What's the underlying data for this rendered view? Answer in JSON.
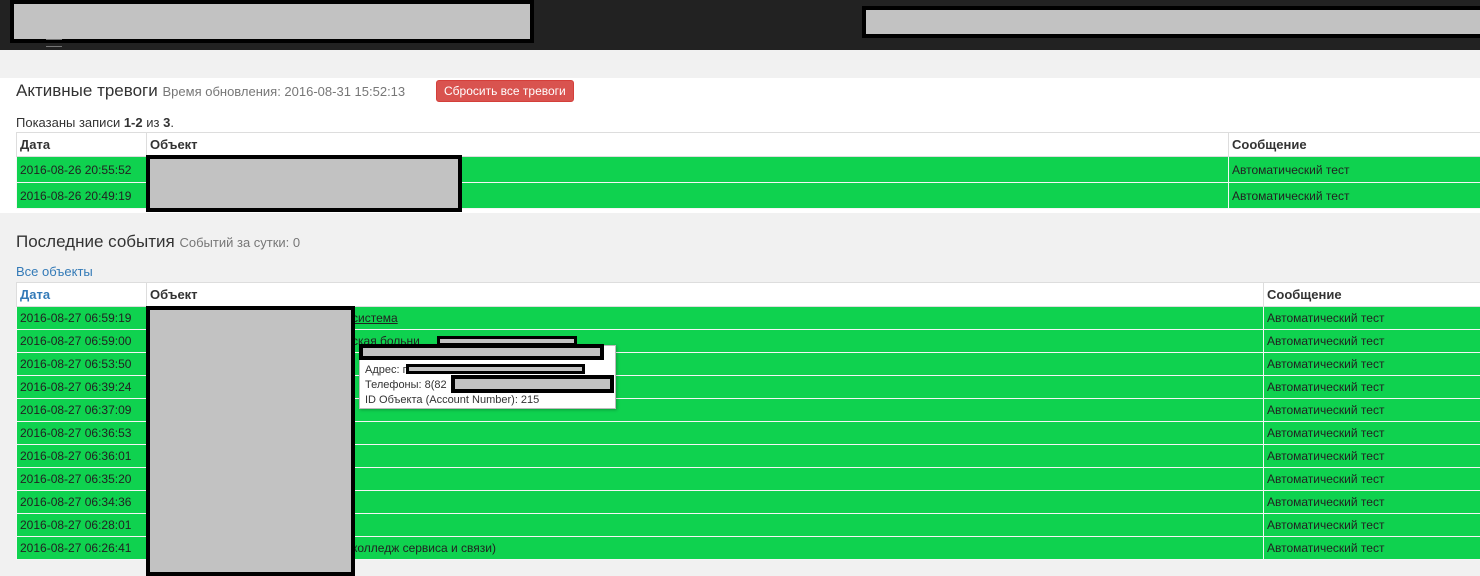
{
  "alarms": {
    "title": "Активные тревоги",
    "update_label": "Время обновления: 2016-08-31 15:52:13",
    "reset_button": "Сбросить все тревоги",
    "summary": {
      "prefix": "Показаны записи ",
      "range": "1-2",
      "middle": " из ",
      "total": "3",
      "suffix": "."
    },
    "columns": {
      "date": "Дата",
      "object": "Объект",
      "message": "Сообщение"
    },
    "rows": [
      {
        "date": "2016-08-26 20:55:52",
        "message": "Автоматический тест"
      },
      {
        "date": "2016-08-26 20:49:19",
        "message": "Автоматический тест"
      }
    ]
  },
  "events": {
    "title": "Последние события",
    "count_label": "Событий за сутки: 0",
    "all_link": "Все объекты",
    "columns": {
      "date": "Дата",
      "object": "Объект",
      "message": "Сообщение"
    },
    "rows": [
      {
        "date": "2016-08-27 06:59:19",
        "object_tail": "система",
        "message": "Автоматический тест"
      },
      {
        "date": "2016-08-27 06:59:00",
        "object_tail": "ская больни",
        "message": "Автоматический тест"
      },
      {
        "date": "2016-08-27 06:53:50",
        "object_tail": "",
        "message": "Автоматический тест"
      },
      {
        "date": "2016-08-27 06:39:24",
        "object_tail": "",
        "message": "Автоматический тест"
      },
      {
        "date": "2016-08-27 06:37:09",
        "object_tail": "",
        "message": "Автоматический тест"
      },
      {
        "date": "2016-08-27 06:36:53",
        "object_tail": "",
        "message": "Автоматический тест"
      },
      {
        "date": "2016-08-27 06:36:01",
        "object_tail": "",
        "message": "Автоматический тест"
      },
      {
        "date": "2016-08-27 06:35:20",
        "object_tail": "",
        "message": "Автоматический тест"
      },
      {
        "date": "2016-08-27 06:34:36",
        "object_tail": "",
        "message": "Автоматический тест"
      },
      {
        "date": "2016-08-27 06:28:01",
        "object_tail": "",
        "message": "Автоматический тест"
      },
      {
        "date": "2016-08-27 06:26:41",
        "object_tail": "колледж сервиса и связи)",
        "message": "Автоматический тест"
      }
    ]
  },
  "tooltip": {
    "address": "Адрес: г",
    "phones": "Телефоны: 8(82",
    "account": "ID Объекта (Account Number): 215"
  },
  "colors": {
    "row_green": "#0fd24f",
    "danger": "#d9534f",
    "link": "#337ab7",
    "topbar": "#222222"
  }
}
